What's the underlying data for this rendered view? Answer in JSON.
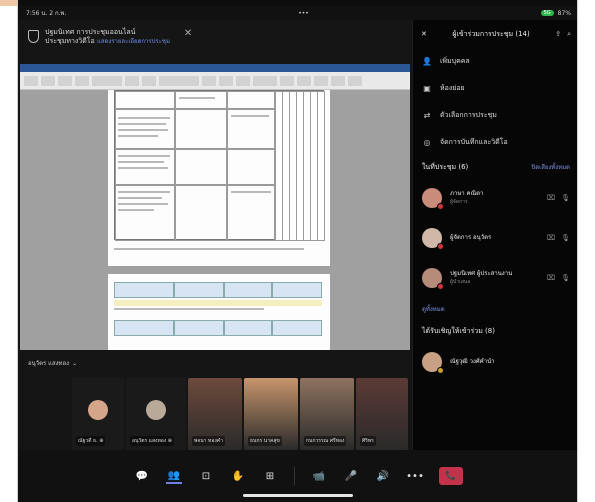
{
  "status": {
    "time": "7:56 น. 2 ก.พ.",
    "dots": "•••",
    "signal": "5G",
    "battery": "87%"
  },
  "meeting": {
    "title": "ปฐมนิเทศ การประชุมออนไลน์",
    "subtitle": "ประชุมทางวิดีโอ",
    "link": "แสดงรายละเอียดการประชุม"
  },
  "presenter": {
    "label": "อนุวัตร  แสงทอง",
    "chevron": "⌄"
  },
  "gallery": [
    {
      "name": "ณัฐวดี ธ. ⊕",
      "type": "avatar",
      "color": "#d4a589"
    },
    {
      "name": "อนุวัตร แสงทอง ⊕",
      "type": "avatar",
      "color": "#b9a999"
    },
    {
      "name": "พจนา ทองคำ",
      "type": "video",
      "color": "#6d4a3c"
    },
    {
      "name": "ธนกร นาคสุข",
      "type": "video",
      "color": "#c7956c"
    },
    {
      "name": "กนกวรรณ ศรีทอง",
      "type": "video",
      "color": "#8f7360"
    },
    {
      "name": "ศิริพร",
      "type": "video",
      "color": "#5b3a35"
    }
  ],
  "panel": {
    "header": "ผู้เข้าร่วมการประชุม (14)",
    "actions": [
      {
        "label": "เพิ่มบุคคล",
        "icon": "add-person-icon",
        "glyph": "👤"
      },
      {
        "label": "ห้องย่อย",
        "icon": "rooms-icon",
        "glyph": "▣"
      },
      {
        "label": "ตัวเลือกการประชุม",
        "icon": "options-icon",
        "glyph": "⇄"
      },
      {
        "label": "จัดการบันทึกและวิดีโอ",
        "icon": "record-icon",
        "glyph": "◎"
      }
    ],
    "in_meeting_label": "ในที่ประชุม (6)",
    "mute_all": "ปิดเสียงทั้งหมด",
    "people": [
      {
        "name": "ภาษา  คณิตา",
        "role": "ผู้จัดการ",
        "color": "#c98b7a"
      },
      {
        "name": "ผู้จัดการ  อนุวัตร",
        "role": "",
        "color": "#d0b8a8"
      },
      {
        "name": "ปฐมนิเทศ  ผู้ประสานงาน",
        "role": "ผู้นำเสนอ",
        "color": "#b58b7a"
      }
    ],
    "see_all": "ดูทั้งหมด",
    "invited_label": "ได้รับเชิญให้เข้าร่วม (8)",
    "invited": {
      "name": "ณัฐวุฒิ  วงศ์คำนำ",
      "color": "#c8a083"
    }
  },
  "toolbar": {
    "chat": "💬",
    "people": "👥",
    "share": "⊡",
    "react": "✋",
    "rooms": "⊞",
    "camera": "📹",
    "mic": "🎤",
    "speaker": "🔊",
    "more": "•••",
    "hangup": "📞"
  }
}
